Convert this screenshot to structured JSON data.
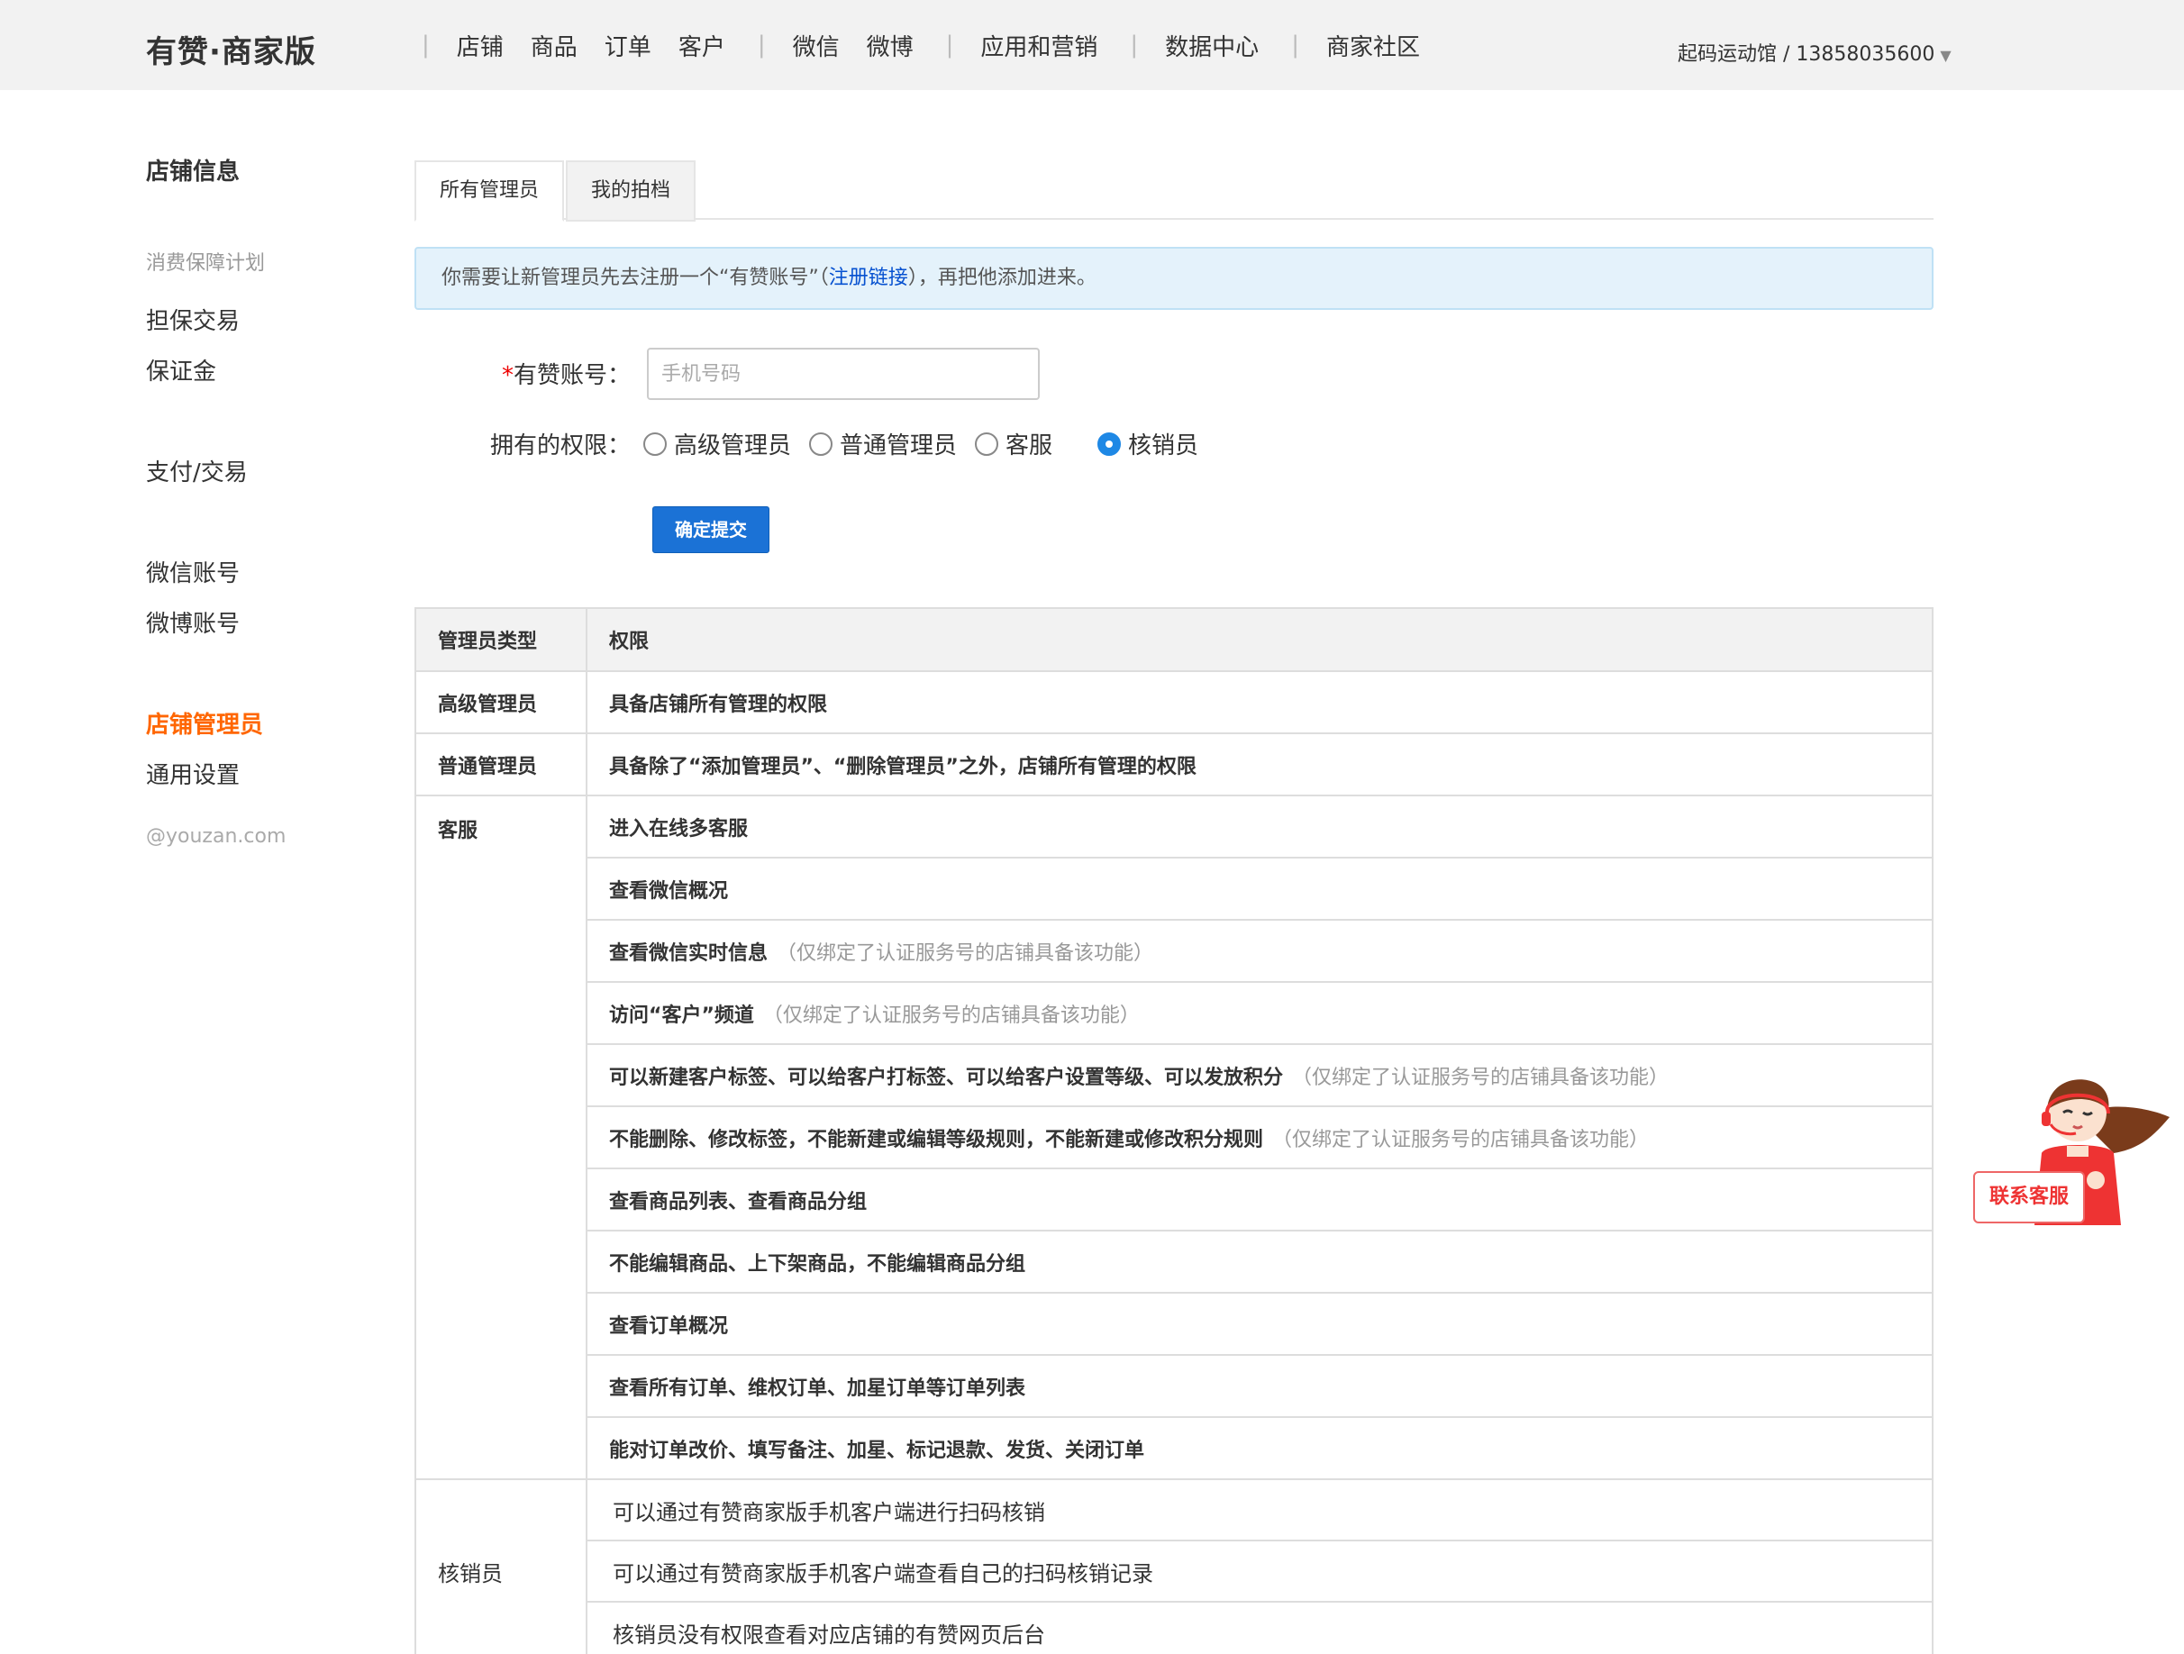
{
  "header": {
    "brand": "有赞·商家版",
    "nav_groups": [
      [
        "店铺",
        "商品",
        "订单",
        "客户"
      ],
      [
        "微信",
        "微博"
      ],
      [
        "应用和营销"
      ],
      [
        "数据中心"
      ],
      [
        "商家社区"
      ]
    ],
    "account": "起码运动馆 / 13858035600",
    "account_caret": "▼"
  },
  "sidebar": {
    "store_info": "店铺信息",
    "consumer_guarantee": "消费保障计划",
    "guarantee_trade": "担保交易",
    "deposit": "保证金",
    "pay_trade": "支付/交易",
    "wechat_account": "微信账号",
    "weibo_account": "微博账号",
    "store_admin": "店铺管理员",
    "general_settings": "通用设置",
    "footer": "@youzan.com"
  },
  "tabs": {
    "all_admins": "所有管理员",
    "my_partners": "我的拍档"
  },
  "notice": {
    "prefix": "你需要让新管理员先去注册一个“有赞账号”（",
    "link": "注册链接",
    "suffix": "），再把他添加进来。"
  },
  "form": {
    "required_mark": "*",
    "account_label": "有赞账号：",
    "account_placeholder": "手机号码",
    "account_value": "",
    "permission_label": "拥有的权限：",
    "roles": [
      "高级管理员",
      "普通管理员",
      "客服",
      "核销员"
    ],
    "selected_role": "核销员",
    "submit": "确定提交"
  },
  "table": {
    "headers": [
      "管理员类型",
      "权限"
    ],
    "senior": {
      "type": "高级管理员",
      "perm": "具备店铺所有管理的权限"
    },
    "normal": {
      "type": "普通管理员",
      "perm": "具备除了“添加管理员”、“删除管理员”之外，店铺所有管理的权限"
    },
    "service": {
      "type": "客服",
      "perms": [
        {
          "text": "进入在线多客服",
          "note": ""
        },
        {
          "text": "查看微信概况",
          "note": ""
        },
        {
          "text": "查看微信实时信息",
          "note": "（仅绑定了认证服务号的店铺具备该功能）"
        },
        {
          "text": "访问“客户”频道",
          "note": "（仅绑定了认证服务号的店铺具备该功能）"
        },
        {
          "text": "可以新建客户标签、可以给客户打标签、可以给客户设置等级、可以发放积分",
          "note": "（仅绑定了认证服务号的店铺具备该功能）"
        },
        {
          "text": "不能删除、修改标签，不能新建或编辑等级规则，不能新建或修改积分规则",
          "note": "（仅绑定了认证服务号的店铺具备该功能）"
        },
        {
          "text": "查看商品列表、查看商品分组",
          "note": ""
        },
        {
          "text": "不能编辑商品、上下架商品，不能编辑商品分组",
          "note": ""
        },
        {
          "text": "查看订单概况",
          "note": ""
        },
        {
          "text": "查看所有订单、维权订单、加星订单等订单列表",
          "note": ""
        },
        {
          "text": "能对订单改价、填写备注、加星、标记退款、发货、关闭订单",
          "note": ""
        }
      ]
    },
    "verifier": {
      "type": "核销员",
      "perms": [
        "可以通过有赞商家版手机客户端进行扫码核销",
        "可以通过有赞商家版手机客户端查看自己的扫码核销记录",
        "核销员没有权限查看对应店铺的有赞网页后台"
      ]
    }
  },
  "customer_service": {
    "label": "联系客服",
    "colors": {
      "accent": "#e33333",
      "brand_blue": "#1b72d6",
      "active_orange": "#ff6600"
    }
  }
}
